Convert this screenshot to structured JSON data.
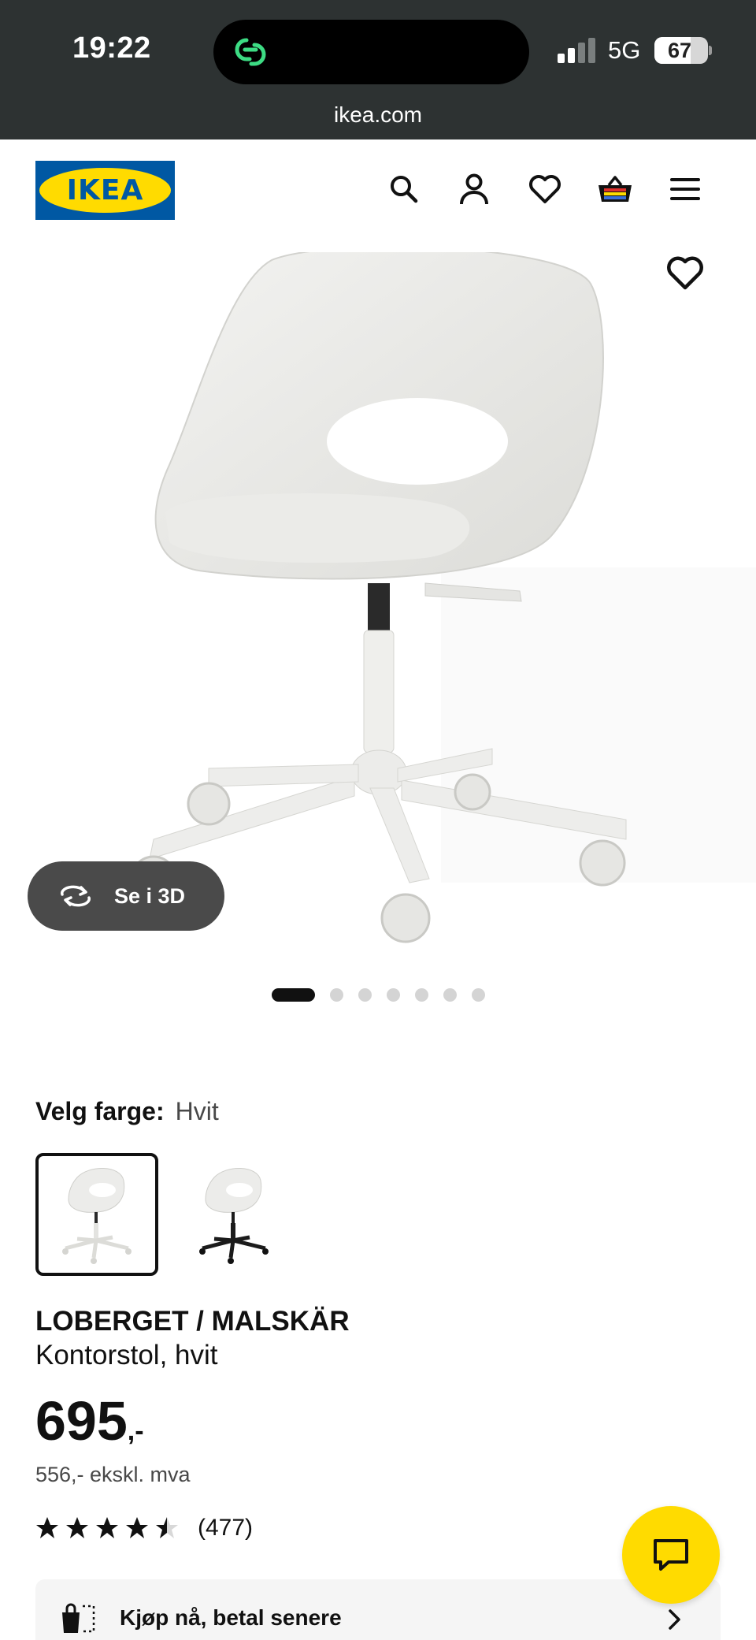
{
  "status_bar": {
    "time": "19:22",
    "network": "5G",
    "battery": "67",
    "battery_level": 0.67
  },
  "browser": {
    "url": "ikea.com"
  },
  "header": {
    "logo_text": "IKEA",
    "icons": [
      "search-icon",
      "profile-icon",
      "heart-icon",
      "shopping-basket-icon",
      "menu-icon"
    ]
  },
  "gallery": {
    "view_3d_label": "Se i 3D",
    "image_count": 7,
    "active_index": 0
  },
  "color": {
    "label": "Velg farge:",
    "selected": "Hvit",
    "options": [
      "white",
      "black"
    ]
  },
  "product": {
    "name": "LOBERGET / MALSKÄR",
    "description": "Kontorstol, hvit",
    "price": "695",
    "price_suffix": ",-",
    "price_ex_vat": "556,- ekskl. mva",
    "rating": 4.5,
    "rating_max": 5,
    "review_count": "(477)"
  },
  "bnpl": {
    "label": "Kjøp nå, betal senere"
  },
  "colors": {
    "ikea_blue": "#0058a3",
    "ikea_yellow": "#ffdb00",
    "status_bar_bg": "#2d3232",
    "pill_bg": "#4a4a4a"
  }
}
